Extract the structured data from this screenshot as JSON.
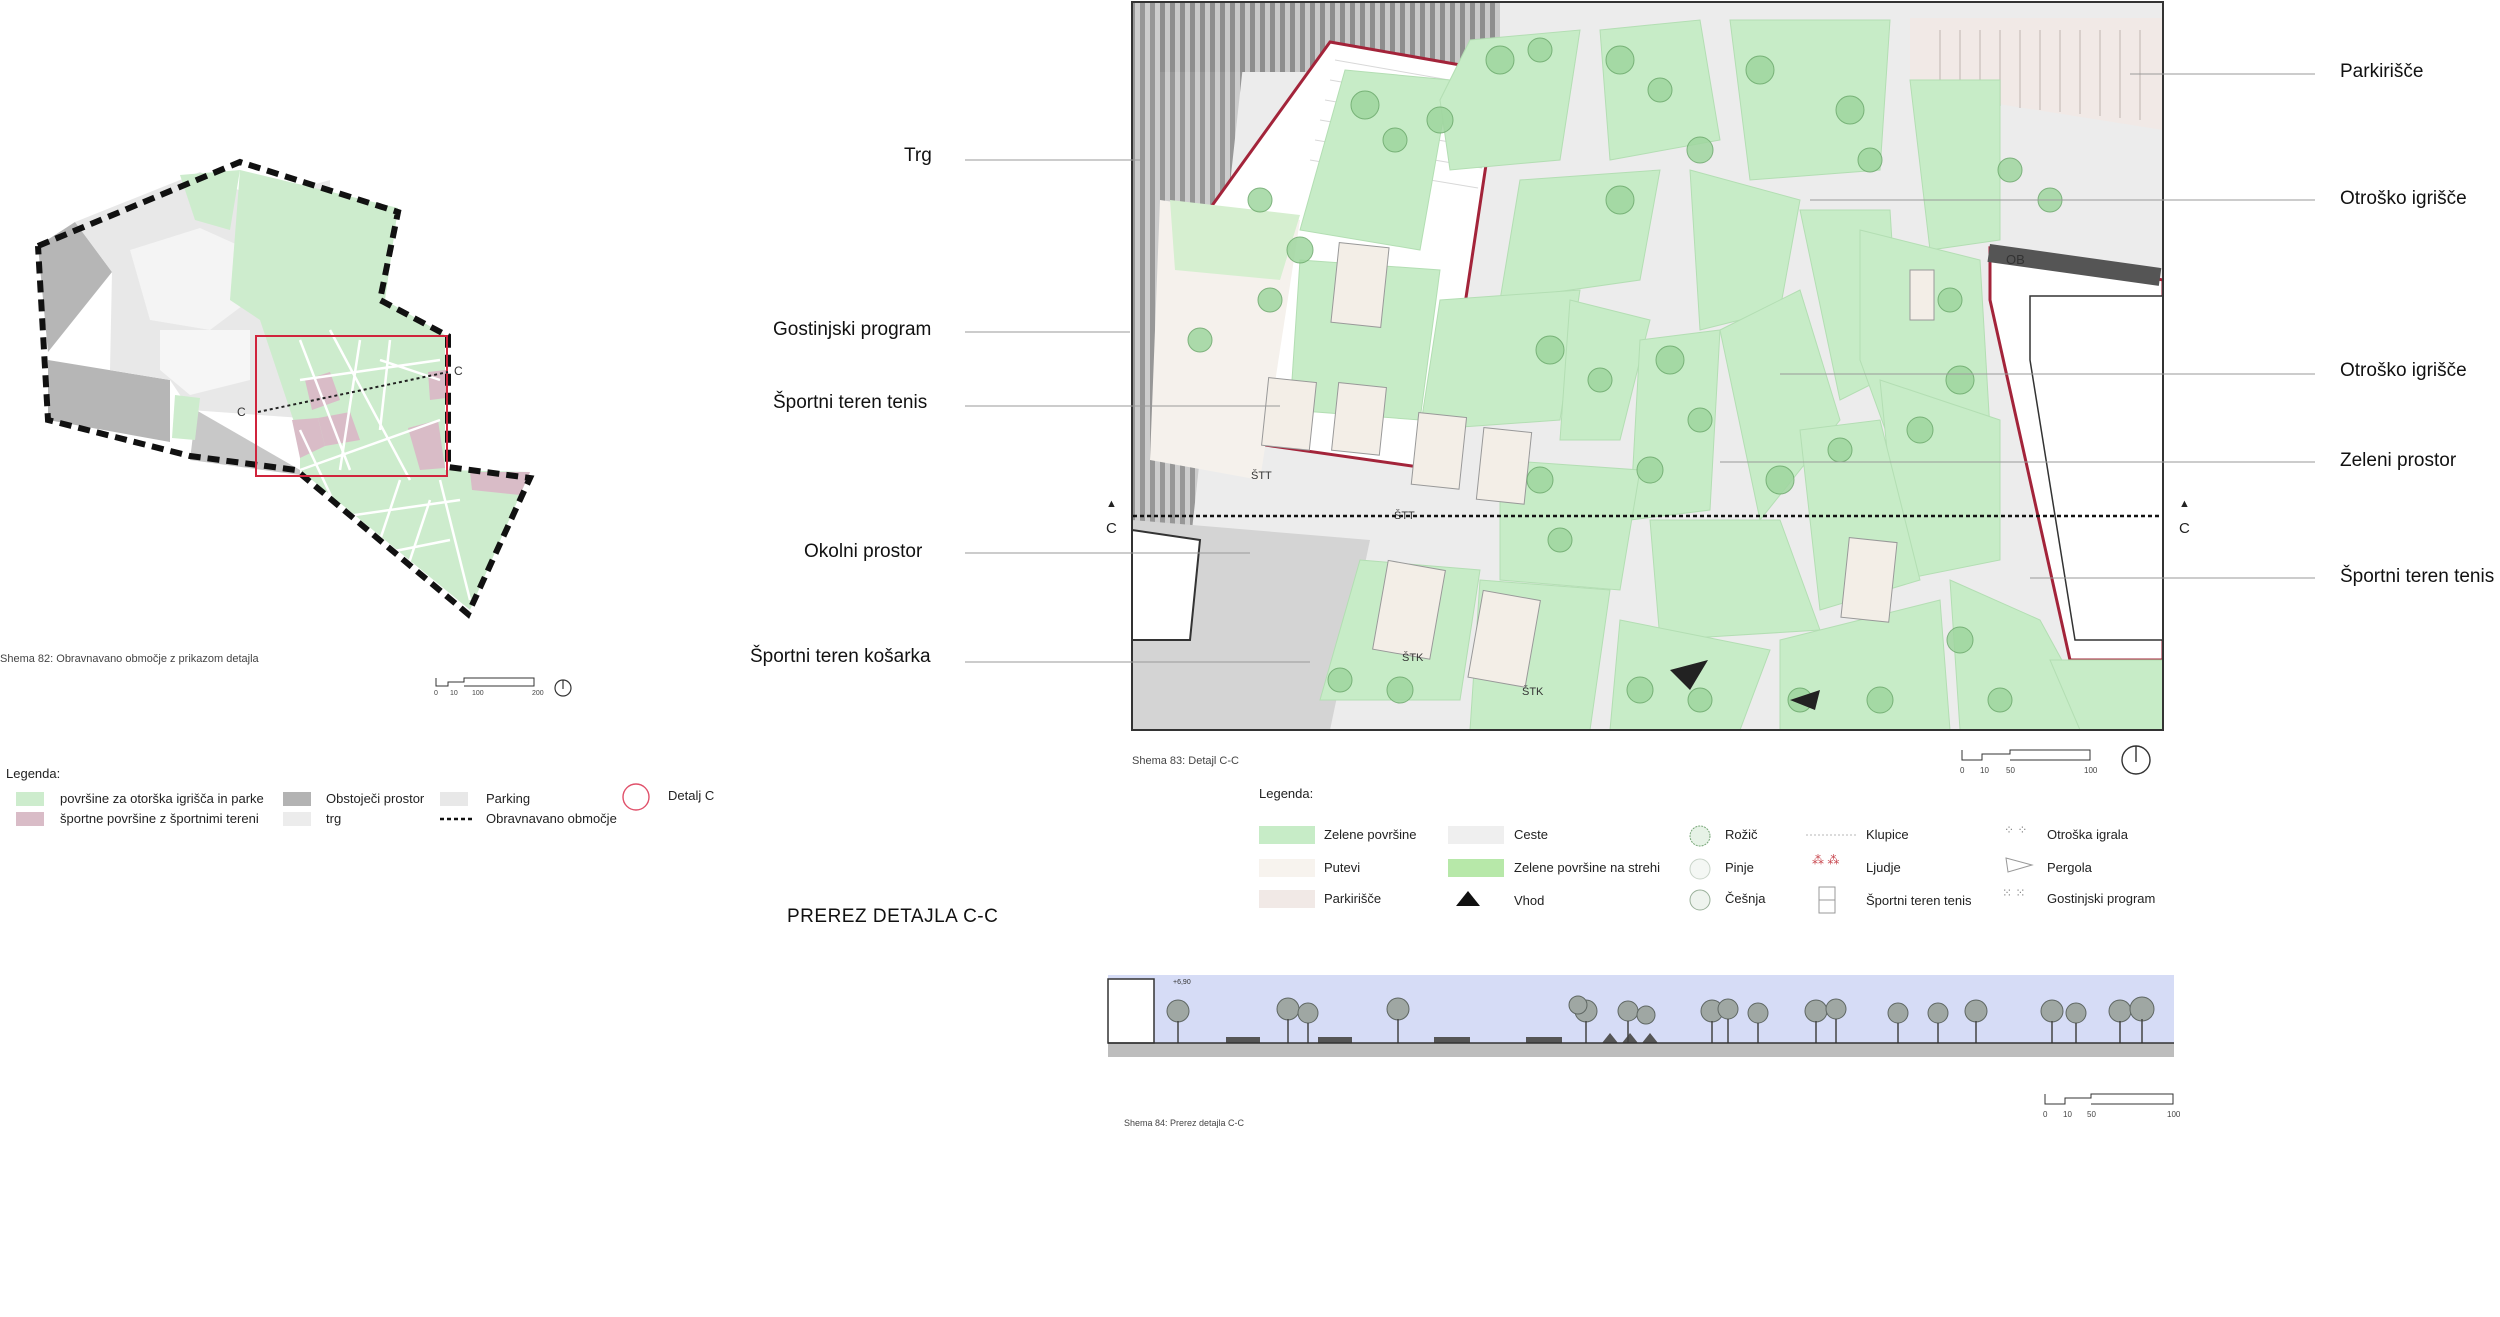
{
  "schema82": {
    "caption": "Shema 82: Obravnavano območje z prikazom detajla",
    "section_marks": [
      "C",
      "C"
    ],
    "scale": [
      "0",
      "10",
      "100",
      "200"
    ]
  },
  "legend1": {
    "title": "Legenda:",
    "items": [
      {
        "label": "površine za otorška igrišča in parke",
        "color": "#cdeccd"
      },
      {
        "label": "športne površine z športnimi tereni",
        "color": "#d9bcc7"
      },
      {
        "label": "Obstoječi prostor",
        "color": "#b3b3b3"
      },
      {
        "label": "trg",
        "color": "#ececec"
      },
      {
        "label": "Parking",
        "color": "#e8e8e8"
      },
      {
        "label": "Obravnavano območje",
        "color": "#111111"
      },
      {
        "label": "Detalj C",
        "color": "#e0506a"
      }
    ]
  },
  "schema83": {
    "caption": "Shema 83: Detajl C-C",
    "section_marks": [
      "C",
      "C"
    ],
    "scale": [
      "0",
      "10",
      "50",
      "100"
    ],
    "map_labels": [
      "ŠTT",
      "ŠTT",
      "ŠTK",
      "ŠTK",
      "OB"
    ]
  },
  "callouts": {
    "left": [
      "Trg",
      "Gostinjski program",
      "Športni teren tenis",
      "Okolni prostor",
      "Športni teren košarka"
    ],
    "right": [
      "Parkirišče",
      "Otroško igrišče",
      "Otroško igrišče",
      "Zeleni prostor",
      "Športni teren tenis"
    ]
  },
  "legend2": {
    "title": "Legenda:",
    "col1": [
      {
        "label": "Zelene površine",
        "color": "#c7ecc7"
      },
      {
        "label": "Putevi",
        "color": "#f7f3ee"
      },
      {
        "label": "Parkirišče",
        "color": "#f1e9e6"
      }
    ],
    "col2": [
      {
        "label": "Ceste",
        "color": "#efefef"
      },
      {
        "label": "Zelene površine na strehi",
        "color": "#b7e8a9"
      },
      {
        "label": "Vhod",
        "color": "#111111"
      }
    ],
    "col3": [
      "Rožič",
      "Pinje",
      "Češnja"
    ],
    "col4": [
      "Klupice",
      "Ljudje",
      "Športni teren tenis"
    ],
    "col5": [
      "Otroška igrala",
      "Pergola",
      "Gostinjski program"
    ]
  },
  "section": {
    "title": "PREREZ DETAJLA  C-C",
    "height_label": "+6,90",
    "caption": "Shema 84: Prerez detajla C-C",
    "scale": [
      "0",
      "10",
      "50",
      "100"
    ]
  }
}
